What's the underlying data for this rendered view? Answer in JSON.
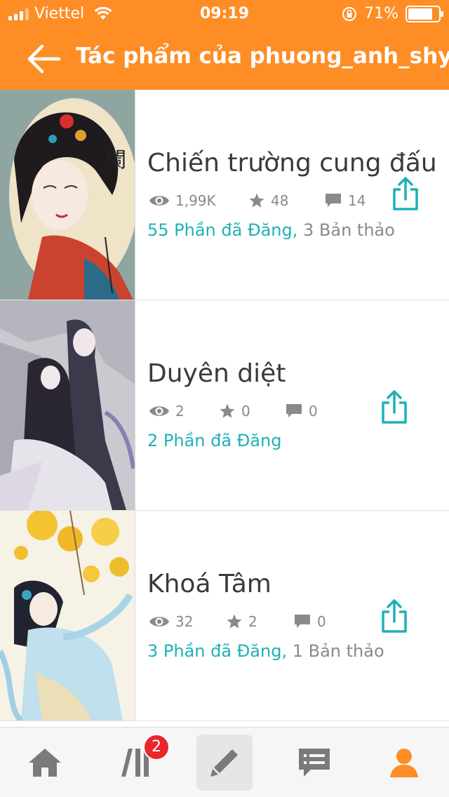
{
  "status_bar": {
    "carrier": "Viettel",
    "time": "09:19",
    "battery": "71%"
  },
  "header": {
    "title": "Tác phẩm của phuong_anh_shyn"
  },
  "stories": [
    {
      "title": "Chiến trường cung đấu",
      "views": "1,99K",
      "votes": "48",
      "comments": "14",
      "published": "55 Phần đã Đăng,",
      "drafts": "3 Bản thảo"
    },
    {
      "title": "Duyên diệt",
      "views": "2",
      "votes": "0",
      "comments": "0",
      "published": "2 Phần đã Đăng",
      "drafts": ""
    },
    {
      "title": "Khoá Tâm",
      "views": "32",
      "votes": "2",
      "comments": "0",
      "published": "3 Phần đã Đăng,",
      "drafts": "1 Bản thảo"
    }
  ],
  "tabbar": {
    "library_badge": "2",
    "icons": [
      "home-icon",
      "library-icon",
      "write-icon",
      "messages-icon",
      "profile-icon"
    ]
  },
  "colors": {
    "accent": "#fe8d26",
    "teal": "#1fb1b6",
    "badge": "#e8262b",
    "muted": "#8a8a8a"
  }
}
